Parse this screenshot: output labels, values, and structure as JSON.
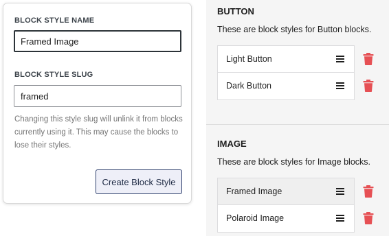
{
  "form": {
    "name_label": "BLOCK STYLE NAME",
    "name_value": "Framed Image",
    "slug_label": "BLOCK STYLE SLUG",
    "slug_value": "framed",
    "help_text": "Changing this style slug will unlink it from blocks currently using it. This may cause the blocks to lose their styles.",
    "submit_label": "Create Block Style"
  },
  "sections": [
    {
      "title": "BUTTON",
      "description": "These are block styles for Button blocks.",
      "items": [
        {
          "label": "Light Button"
        },
        {
          "label": "Dark Button"
        }
      ]
    },
    {
      "title": "IMAGE",
      "description": "These are block styles for Image blocks.",
      "items": [
        {
          "label": "Framed Image"
        },
        {
          "label": "Polaroid Image"
        }
      ]
    }
  ],
  "icons": {
    "drag": "drag-handle-icon",
    "delete": "trash-icon"
  },
  "colors": {
    "delete_icon": "#e65054",
    "button_border": "#2c3e6b",
    "button_bg": "#eeeff8",
    "active_row": "#efefef"
  }
}
